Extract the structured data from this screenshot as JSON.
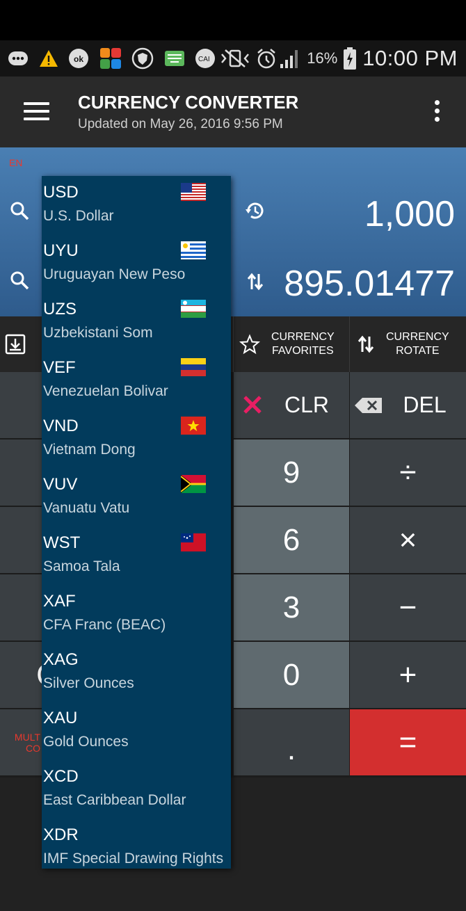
{
  "status_bar": {
    "battery_percent": "16%",
    "time": "10:00 PM"
  },
  "toolbar": {
    "title": "CURRENCY CONVERTER",
    "subtitle": "Updated on May 26, 2016 9:56 PM"
  },
  "panel": {
    "lang": "EN",
    "amount_top": "1,000",
    "amount_bottom": "895.01477"
  },
  "buttons": {
    "favorites": "CURRENCY\nFAVORITES",
    "rotate": "CURRENCY\nROTATE"
  },
  "keypad": {
    "clr": "CLR",
    "del": "DEL",
    "nine": "9",
    "divide": "÷",
    "six": "6",
    "multiply": "×",
    "three": "3",
    "minus": "−",
    "zero": "0",
    "plus": "+",
    "dot": ".",
    "equals": "=",
    "partial_c": "C",
    "partial_c2": "C",
    "partial_mult": "MULT",
    "partial_co": "CO"
  },
  "currency_list": [
    {
      "code": "USD",
      "name": "U.S. Dollar",
      "flag": "usa-flag"
    },
    {
      "code": "UYU",
      "name": "Uruguayan New Peso",
      "flag": "uruguay-flag"
    },
    {
      "code": "UZS",
      "name": "Uzbekistani Som",
      "flag": "uzbekistan-flag"
    },
    {
      "code": "VEF",
      "name": "Venezuelan Bolivar",
      "flag": "venezuela-flag"
    },
    {
      "code": "VND",
      "name": "Vietnam Dong",
      "flag": "vietnam-flag"
    },
    {
      "code": "VUV",
      "name": "Vanuatu Vatu",
      "flag": "vanuatu-flag"
    },
    {
      "code": "WST",
      "name": "Samoa Tala",
      "flag": "samoa-flag"
    },
    {
      "code": "XAF",
      "name": "CFA Franc (BEAC)",
      "flag": ""
    },
    {
      "code": "XAG",
      "name": "Silver Ounces",
      "flag": ""
    },
    {
      "code": "XAU",
      "name": "Gold Ounces",
      "flag": ""
    },
    {
      "code": "XCD",
      "name": "East Caribbean Dollar",
      "flag": ""
    },
    {
      "code": "XDR",
      "name": "IMF Special Drawing Rights",
      "flag": ""
    }
  ],
  "colors": {
    "accent_red": "#d32f2f",
    "panel_blue": "#3b6ea3",
    "dropdown_bg": "#023b5c"
  }
}
